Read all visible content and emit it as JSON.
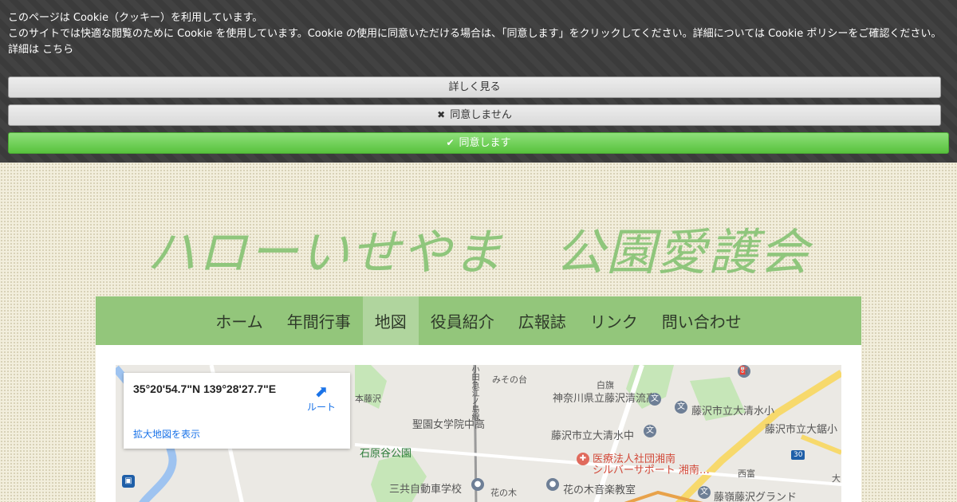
{
  "cookie": {
    "line1": "このページは Cookie（クッキー）を利用しています。",
    "line2": "このサイトでは快適な閲覧のために Cookie を使用しています。Cookie の使用に同意いただける場合は、「同意します」をクリックしてください。詳細については Cookie ポリシーをご確認ください。",
    "detail_prefix": "詳細は",
    "detail_link": "こちら",
    "more_button": "詳しく見る",
    "decline_button": "同意しません",
    "accept_button": "同意します"
  },
  "site": {
    "title": "ハローいせやま　公園愛護会"
  },
  "nav": {
    "items": [
      "ホーム",
      "年間行事",
      "地図",
      "役員紹介",
      "広報誌",
      "リンク",
      "問い合わせ"
    ],
    "active_index": 2
  },
  "map": {
    "coordinates": "35°20'54.7\"N 139°28'27.7\"E",
    "route_label": "ルート",
    "enlarge_label": "拡大地図を表示",
    "labels": {
      "motofujisawa": "本藤沢",
      "misonodai": "みその台",
      "shirahata": "白旗",
      "seiryu": "神奈川県立藤沢清流高",
      "oshimizu_sho": "藤沢市立大清水小",
      "oshimizu_chu": "藤沢市立大清水中",
      "oshiro": "藤沢市立大鋸小",
      "seikou": "聖園女学院中高",
      "ishiharaya": "石原谷公園",
      "sankyo": "三共自動車学校",
      "hananoki": "花の木",
      "hananoki_music": "花の木音楽教室",
      "shonan_line1": "医療法人社団湘南",
      "shonan_line2": "シルバーサポート 湘南…",
      "nishitomi": "西富",
      "fujirei": "藤嶺藤沢グランド",
      "railway": "小田急江ノ島線",
      "road_30": "30",
      "daiku": "大"
    }
  }
}
